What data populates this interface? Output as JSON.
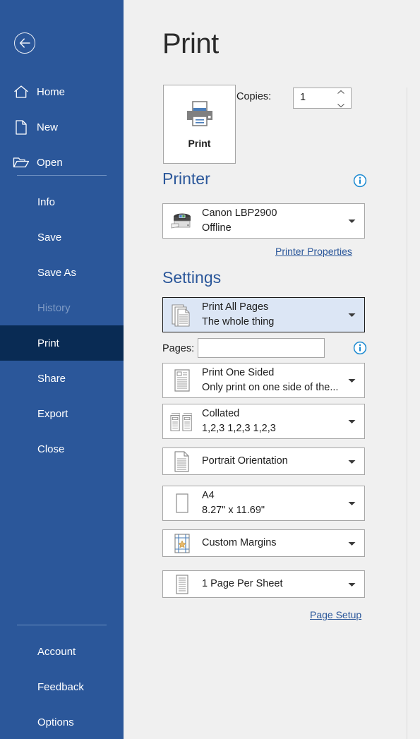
{
  "sidebar": {
    "back_label": "Back",
    "top_items": [
      {
        "label": "Home",
        "icon": "home-icon"
      },
      {
        "label": "New",
        "icon": "new-document-icon"
      },
      {
        "label": "Open",
        "icon": "open-folder-icon"
      }
    ],
    "items": [
      {
        "label": "Info",
        "state": "normal"
      },
      {
        "label": "Save",
        "state": "normal"
      },
      {
        "label": "Save As",
        "state": "normal"
      },
      {
        "label": "History",
        "state": "disabled"
      },
      {
        "label": "Print",
        "state": "selected"
      },
      {
        "label": "Share",
        "state": "normal"
      },
      {
        "label": "Export",
        "state": "normal"
      },
      {
        "label": "Close",
        "state": "normal"
      }
    ],
    "bottom_items": [
      {
        "label": "Account"
      },
      {
        "label": "Feedback"
      },
      {
        "label": "Options"
      }
    ],
    "colors": {
      "background": "#2b579a",
      "selected": "#092b54",
      "text": "#ffffff",
      "disabled_text": "#7e9ac4"
    }
  },
  "main": {
    "title": "Print",
    "print_button": {
      "label": "Print",
      "icon": "printer-icon"
    },
    "copies": {
      "label": "Copies:",
      "value": "1",
      "up_icon": "chevron-up-icon",
      "down_icon": "chevron-down-icon"
    },
    "printer_section": {
      "heading": "Printer",
      "info_icon": "info-icon",
      "selected": {
        "name": "Canon LBP2900",
        "status": "Offline",
        "icon": "printer-device-icon"
      },
      "properties_link": "Printer Properties"
    },
    "settings_section": {
      "heading": "Settings",
      "pages_label": "Pages:",
      "pages_value": "",
      "pages_placeholder": "",
      "pages_info_icon": "info-icon",
      "page_setup_link": "Page Setup",
      "options": [
        {
          "name": "print-range",
          "main": "Print All Pages",
          "sub": "The whole thing",
          "icon": "stacked-pages-icon",
          "highlighted": true
        },
        {
          "name": "print-sides",
          "main": "Print One Sided",
          "sub": "Only print on one side of the...",
          "icon": "one-sided-page-icon",
          "highlighted": false
        },
        {
          "name": "collation",
          "main": "Collated",
          "sub": "1,2,3    1,2,3    1,2,3",
          "icon": "collate-icon",
          "highlighted": false
        },
        {
          "name": "orientation",
          "main": "Portrait Orientation",
          "sub": "",
          "icon": "portrait-page-icon",
          "highlighted": false
        },
        {
          "name": "paper-size",
          "main": "A4",
          "sub": "8.27\" x 11.69\"",
          "icon": "paper-size-icon",
          "highlighted": false
        },
        {
          "name": "margins",
          "main": "Custom Margins",
          "sub": "",
          "icon": "margins-icon",
          "highlighted": false
        },
        {
          "name": "pages-per-sheet",
          "main": "1 Page Per Sheet",
          "sub": "",
          "icon": "pages-per-sheet-icon",
          "highlighted": false
        }
      ]
    },
    "colors": {
      "accent": "#2b579a",
      "background": "#f0f0f0",
      "highlight": "#dce6f5",
      "link": "#2b579a"
    }
  }
}
